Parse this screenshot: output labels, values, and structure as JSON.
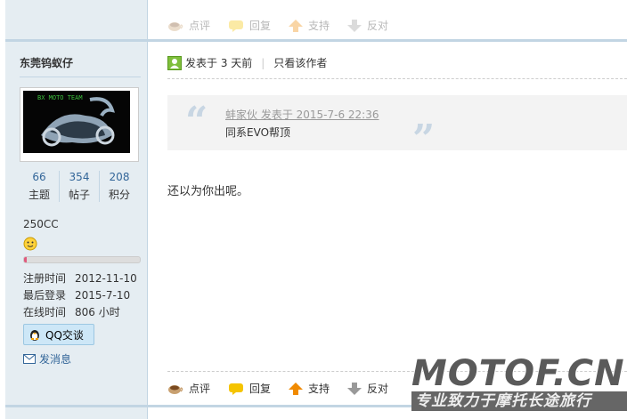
{
  "top_actions": {
    "rate": "点评",
    "reply": "回复",
    "support": "支持",
    "oppose": "反对"
  },
  "user": {
    "name": "东莞钨蚁仔",
    "avatar_text": "BX MOTO TEAM",
    "stats": [
      {
        "value": "66",
        "label": "主题"
      },
      {
        "value": "354",
        "label": "帖子"
      },
      {
        "value": "208",
        "label": "积分"
      }
    ],
    "group": "250CC",
    "progress": 0.02,
    "info": [
      {
        "key": "注册时间",
        "value": "2012-11-10"
      },
      {
        "key": "最后登录",
        "value": "2015-7-10"
      },
      {
        "key": "在线时间",
        "value": "806 小时"
      }
    ],
    "qq_label": "QQ交谈",
    "msg_label": "发消息"
  },
  "post": {
    "posted": "发表于 3 天前",
    "author_only": "只看该作者",
    "quote_head": "蚌家伙 发表于 2015-7-6 22:36",
    "quote_body": "同系EVO帮顶",
    "body": "还以为你出呢。"
  },
  "bottom_actions": {
    "rate": "点评",
    "reply": "回复",
    "support": "支持",
    "oppose": "反对"
  },
  "watermark": {
    "logo": "MOTOF.CN",
    "slogan": "专业致力于摩托长途旅行"
  },
  "colors": {
    "sidebar": "#e5edf2",
    "border": "#c2d5e3",
    "link": "#336699",
    "progress": "#e05a7e"
  }
}
